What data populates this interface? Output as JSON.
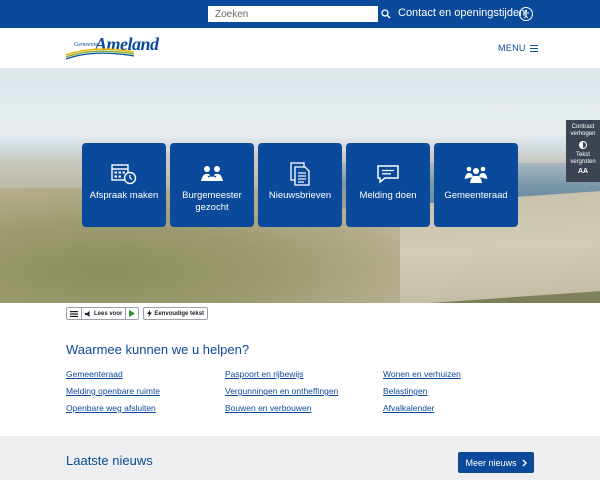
{
  "topbar": {
    "search_placeholder": "Zoeken",
    "contact_label": "Contact en openingstijden"
  },
  "header": {
    "logo_small": "Gemeente",
    "logo_big": "Ameland",
    "menu_label": "MENU"
  },
  "tiles": [
    {
      "label": "Afspraak maken",
      "icon": "calendar-clock-icon"
    },
    {
      "label": "Burgemeester gezocht",
      "icon": "people-icon"
    },
    {
      "label": "Nieuwsbrieven",
      "icon": "documents-icon"
    },
    {
      "label": "Melding doen",
      "icon": "chat-icon"
    },
    {
      "label": "Gemeenteraad",
      "icon": "group-icon"
    }
  ],
  "side_panel": {
    "contrast_label": "Contrast verhogen",
    "text_label": "Tekst vergroten",
    "text_icon": "AA"
  },
  "readspeaker": {
    "read_label": "Lees voor",
    "simple_text_label": "Eenvoudige tekst"
  },
  "help": {
    "title": "Waarmee kunnen we u helpen?",
    "links": [
      "Gemeenteraad",
      "Paspoort en rijbewijs",
      "Wonen en verhuizen",
      "Melding openbare ruimte",
      "Vergunningen en ontheffingen",
      "Belastingen",
      "Openbare weg afsluiten",
      "Bouwen en verbouwen",
      "Afvalkalender"
    ]
  },
  "news": {
    "title": "Laatste nieuws",
    "more_label": "Meer nieuws"
  },
  "colors": {
    "brand_blue": "#0b4a9a",
    "news_background": "#eceef0"
  }
}
